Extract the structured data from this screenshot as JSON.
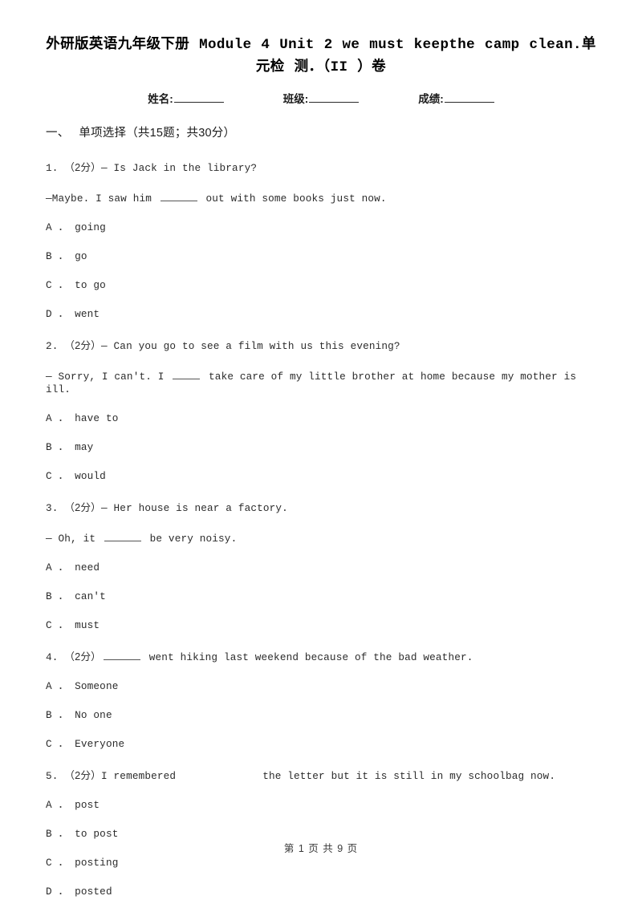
{
  "document": {
    "title_line_1": "外研版英语九年级下册 Module 4 Unit 2 we must keepthe camp clean.单元检",
    "title_line_2": "测．（II ）卷",
    "identity": [
      {
        "label": "姓名:",
        "value": ""
      },
      {
        "label": "班级:",
        "value": ""
      },
      {
        "label": "成绩:",
        "value": ""
      }
    ],
    "section": {
      "index": "一、",
      "title": "单项选择（共15题；共30分）"
    },
    "questions": [
      {
        "number": "1.",
        "points": "（2分）",
        "stem_before": "— Is Jack in the library?",
        "stem_second_before": "—Maybe. I saw him ",
        "stem_second_after": " out with some books just now.",
        "options": [
          "A ． going",
          "B ． go",
          "C ． to go",
          "D ． went"
        ]
      },
      {
        "number": "2.",
        "points": "（2分）",
        "stem_before": "— Can you go to see a film with us this evening?",
        "stem_second_before": "— Sorry, I can't. I ",
        "stem_second_after": " take care of my little brother at home because my mother is ill.",
        "options": [
          "A ． have to",
          "B ． may",
          "C ． would"
        ]
      },
      {
        "number": "3.",
        "points": "（2分）",
        "stem_before": "— Her house is near a factory.",
        "stem_second_before": "— Oh, it ",
        "stem_second_after": " be very noisy.",
        "options": [
          "A ． need",
          "B ． can't",
          "C ． must"
        ]
      },
      {
        "number": "4.",
        "points": "（2分）",
        "stem_before": "",
        "stem_after": " went hiking last weekend because of the bad weather.",
        "options": [
          "A ． Someone",
          "B ． No one",
          "C ． Everyone"
        ]
      },
      {
        "number": "5.",
        "points": "（2分）",
        "stem_before": "I remembered",
        "stem_after": "the letter but it is still in my schoolbag now.",
        "options": [
          "A ． post",
          "B ． to post",
          "C ． posting",
          "D ． posted"
        ]
      }
    ],
    "footer": "第 1 页 共 9 页"
  }
}
